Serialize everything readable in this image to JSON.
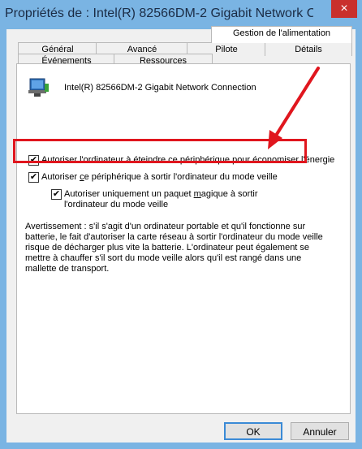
{
  "window": {
    "title": "Propriétés de : Intel(R) 82566DM-2 Gigabit Network C...",
    "close_label": "×"
  },
  "tabs_back": [
    {
      "label": "Général"
    },
    {
      "label": "Avancé"
    },
    {
      "label": "Pilote"
    },
    {
      "label": "Détails"
    }
  ],
  "tabs_front": [
    {
      "label": "Événements"
    },
    {
      "label": "Ressources"
    },
    {
      "label": "Gestion de l'alimentation",
      "active": true
    }
  ],
  "device": {
    "name": "Intel(R) 82566DM-2 Gigabit Network Connection",
    "icon": "network-adapter-icon"
  },
  "options": {
    "allow_turn_off": {
      "label": "Autoriser l'ordinateur à éteindre ce périphérique pour économiser l'énergie",
      "checked": "✔"
    },
    "allow_wake": {
      "label_pre": "Autoriser ",
      "label_u": "c",
      "label_post": "e périphérique à sortir l'ordinateur du mode veille",
      "checked": "✔"
    },
    "magic_packet": {
      "label_pre": "Autoriser uniquement un paquet ",
      "label_u": "m",
      "label_post": "agique à sortir",
      "label_line2": "l'ordinateur du mode veille",
      "checked": "✔"
    }
  },
  "warning": {
    "lines": [
      "Avertissement : s'il s'agit d'un ordinateur portable et qu'il fonctionne sur",
      "batterie, le fait d'autoriser la carte réseau à sortir l'ordinateur du mode veille",
      "risque de décharger plus vite la batterie. L'ordinateur peut également se",
      "mettre à chauffer s'il sort du mode veille alors qu'il est rangé dans une",
      "mallette de transport."
    ]
  },
  "buttons": {
    "ok": "OK",
    "cancel": "Annuler"
  },
  "colors": {
    "title_bar": "#7ab4e3",
    "close_button": "#c9302c",
    "highlight": "#e0161e"
  }
}
